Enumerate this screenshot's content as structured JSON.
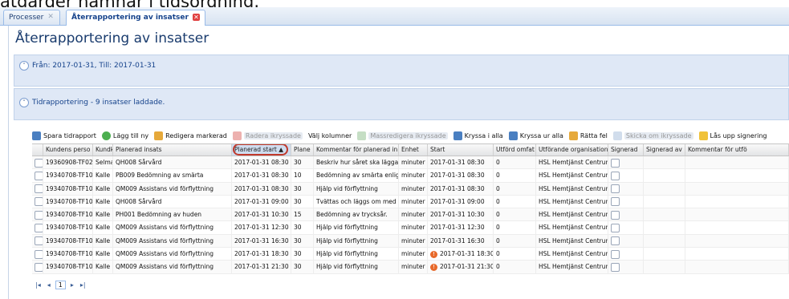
{
  "caption": "åtgärder hamnar i tidsordning.",
  "tabs": [
    {
      "label": "Processer",
      "active": false
    },
    {
      "label": "Återrapportering av insatser",
      "active": true
    }
  ],
  "page_title": "Återrapportering av insatser",
  "filter_panel": {
    "label": "Från: 2017-01-31, Till: 2017-01-31"
  },
  "report_panel": {
    "label": "Tidrapportering - 9 insatser laddade."
  },
  "toolbar": {
    "save": "Spara tidrapport",
    "add": "Lägg till ny",
    "edit": "Redigera markerad",
    "delete": "Radera ikryssade",
    "columns": "Välj kolumner",
    "mass_edit": "Massredigera ikryssade",
    "check_all": "Kryssa i alla",
    "uncheck_all": "Kryssa ur alla",
    "fix": "Rätta fel",
    "resend": "Skicka om ikryssade",
    "unlock": "Lås upp signering"
  },
  "columns": [
    "",
    "Kundens perso",
    "Kundk",
    "Planerad insats",
    "Planerad start ▲",
    "Plane",
    "Kommentar för planerad in",
    "Enhet",
    "Start",
    "Utförd omfat",
    "Utförande organisation",
    "Signerad",
    "Signerad av",
    "Kommentar för utfö"
  ],
  "rows": [
    {
      "pnr": "19360908-TF02",
      "kund": "Selma S",
      "insats": "QH008 Sårvård",
      "start": "2017-01-31 08:30",
      "plan": "30",
      "komm": "Beskriv hur såret ska läggas o",
      "enhet": "minuter",
      "ustart": "2017-01-31 08:30",
      "warn": false,
      "omf": "0",
      "org": "HSL Hemtjänst Centrum"
    },
    {
      "pnr": "19340708-TF10",
      "kund": "Kalle Sjö",
      "insats": "PB009 Bedömning av smärta",
      "start": "2017-01-31 08:30",
      "plan": "10",
      "komm": "Bedömning av smärta enligt V",
      "enhet": "minuter",
      "ustart": "2017-01-31 08:30",
      "warn": false,
      "omf": "0",
      "org": "HSL Hemtjänst Centrum"
    },
    {
      "pnr": "19340708-TF10",
      "kund": "Kalle Sjö",
      "insats": "QM009 Assistans vid förflyttning",
      "start": "2017-01-31 08:30",
      "plan": "30",
      "komm": "Hjälp vid förflyttning",
      "enhet": "minuter",
      "ustart": "2017-01-31 08:30",
      "warn": false,
      "omf": "0",
      "org": "HSL Hemtjänst Centrum"
    },
    {
      "pnr": "19340708-TF10",
      "kund": "Kalle Sjö",
      "insats": "QH008 Sårvård",
      "start": "2017-01-31 09:00",
      "plan": "30",
      "komm": "Tvättas och läggs om med xc",
      "enhet": "minuter",
      "ustart": "2017-01-31 09:00",
      "warn": false,
      "omf": "0",
      "org": "HSL Hemtjänst Centrum"
    },
    {
      "pnr": "19340708-TF10",
      "kund": "Kalle Sjö",
      "insats": "PH001 Bedömning av huden",
      "start": "2017-01-31 10:30",
      "plan": "15",
      "komm": "Bedömning av trycksår.",
      "enhet": "minuter",
      "ustart": "2017-01-31 10:30",
      "warn": false,
      "omf": "0",
      "org": "HSL Hemtjänst Centrum"
    },
    {
      "pnr": "19340708-TF10",
      "kund": "Kalle Sjö",
      "insats": "QM009 Assistans vid förflyttning",
      "start": "2017-01-31 12:30",
      "plan": "30",
      "komm": "Hjälp vid förflyttning",
      "enhet": "minuter",
      "ustart": "2017-01-31 12:30",
      "warn": false,
      "omf": "0",
      "org": "HSL Hemtjänst Centrum"
    },
    {
      "pnr": "19340708-TF10",
      "kund": "Kalle Sjö",
      "insats": "QM009 Assistans vid förflyttning",
      "start": "2017-01-31 16:30",
      "plan": "30",
      "komm": "Hjälp vid förflyttning",
      "enhet": "minuter",
      "ustart": "2017-01-31 16:30",
      "warn": false,
      "omf": "0",
      "org": "HSL Hemtjänst Centrum"
    },
    {
      "pnr": "19340708-TF10",
      "kund": "Kalle Sjö",
      "insats": "QM009 Assistans vid förflyttning",
      "start": "2017-01-31 18:30",
      "plan": "30",
      "komm": "Hjälp vid förflyttning",
      "enhet": "minuter",
      "ustart": "2017-01-31 18:30",
      "warn": true,
      "omf": "0",
      "org": "HSL Hemtjänst Centrum"
    },
    {
      "pnr": "19340708-TF10",
      "kund": "Kalle Sjö",
      "insats": "QM009 Assistans vid förflyttning",
      "start": "2017-01-31 21:30",
      "plan": "30",
      "komm": "Hjälp vid förflyttning",
      "enhet": "minuter",
      "ustart": "2017-01-31 21:30",
      "warn": true,
      "omf": "0",
      "org": "HSL Hemtjänst Centrum"
    }
  ],
  "pager": {
    "page": "1"
  },
  "colors": {
    "accent": "#15428b",
    "panel_bg": "#dfe8f6",
    "warning": "#e8692a",
    "highlight": "#c0392b"
  },
  "icons": {
    "close_inactive": "✕",
    "close_active": "✕",
    "warning": "!",
    "expand": "˅",
    "collapse": "˄",
    "first": "|◂",
    "prev": "◂",
    "next": "▸",
    "last": "▸|"
  }
}
